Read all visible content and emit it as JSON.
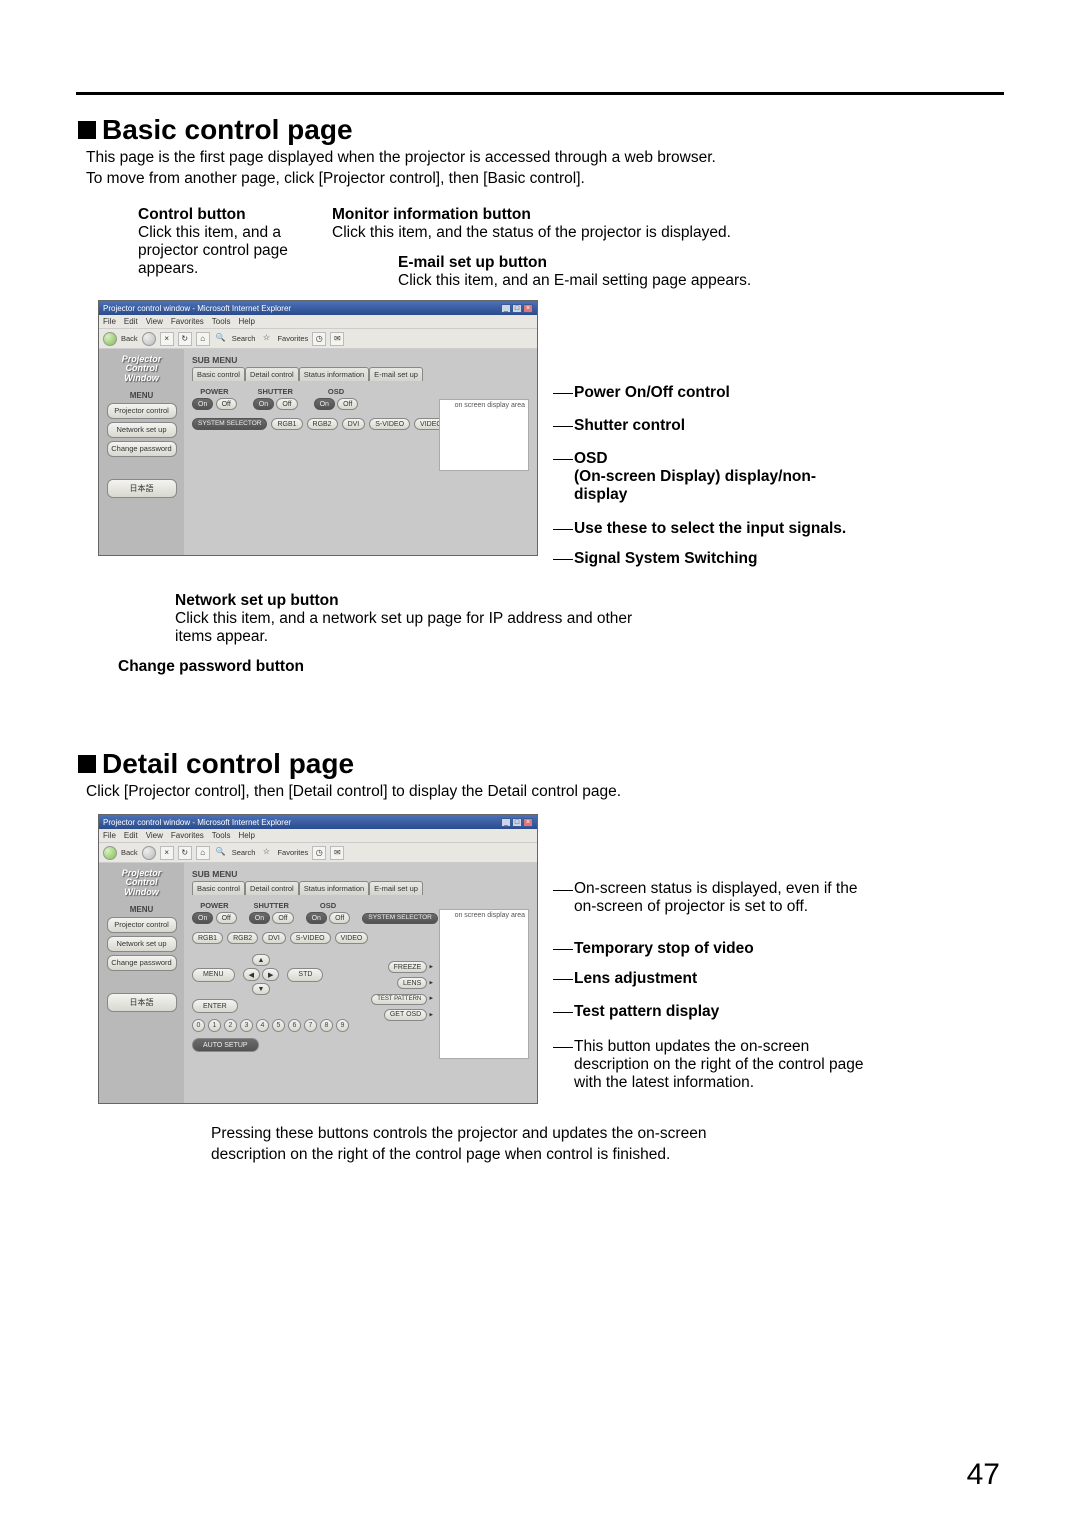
{
  "pageNumber": "47",
  "section1": {
    "title": "Basic control page",
    "intro1": "This page is the first page displayed when the projector is accessed through a web browser.",
    "intro2": "To move from another page, click [Projector control], then [Basic control].",
    "callouts": {
      "controlBtn": {
        "title": "Control button",
        "text": "Click this item, and a projector control page appears."
      },
      "monitorBtn": {
        "title": "Monitor information button",
        "text": "Click this item, and the status of the projector is displayed."
      },
      "emailBtn": {
        "title": "E-mail set up button",
        "text": "Click this item, and an E-mail setting page appears."
      },
      "networkBtn": {
        "title": "Network set up button",
        "text": "Click this item, and a network set up page for IP address and other items appear."
      },
      "changePw": {
        "title": "Change password button"
      },
      "right": {
        "power": "Power On/Off control",
        "shutter": "Shutter control",
        "osdTitle": "OSD",
        "osdSub": "(On-screen Display) display/non-display",
        "inputs": "Use these to select the input signals.",
        "signal": "Signal System Switching"
      }
    }
  },
  "section2": {
    "title": "Detail control page",
    "intro": "Click [Projector control], then [Detail control] to display the Detail control page.",
    "callouts": {
      "osdStatus": "On-screen status is displayed, even if the on-screen of projector is set to off.",
      "freeze": "Temporary stop of video",
      "lens": "Lens adjustment",
      "testPattern": "Test pattern display",
      "getOsd": "This button updates the on-screen description on the right of the control page with the latest information.",
      "bottom": "Pressing these buttons controls the projector and updates the on-screen description on the right of the control page when control is finished."
    }
  },
  "ie": {
    "title": "Projector control window - Microsoft Internet Explorer",
    "menu": [
      "File",
      "Edit",
      "View",
      "Favorites",
      "Tools",
      "Help"
    ],
    "toolSearch": "Search",
    "toolFav": "Favorites",
    "back": "Back"
  },
  "pcw": {
    "logo1": "Projector",
    "logo2": "Control",
    "logo3": "Window",
    "menuLabel": "MENU",
    "sideButtons": {
      "projectorControl": "Projector control",
      "networkSetup": "Network set up",
      "changePassword": "Change password"
    },
    "langBtn": "日本語",
    "subMenu": "SUB MENU",
    "tabs": {
      "basic": "Basic control",
      "detail": "Detail control",
      "status": "Status information",
      "email": "E-mail set up"
    },
    "osdAreaLabel": "on screen display area",
    "groups": {
      "power": "POWER",
      "shutter": "SHUTTER",
      "osd": "OSD",
      "on": "On",
      "off": "Off",
      "systemSelector": "SYSTEM SELECTOR",
      "inputs": [
        "RGB1",
        "RGB2",
        "DVI",
        "S-VIDEO",
        "VIDEO"
      ]
    },
    "detail": {
      "freeze": "FREEZE",
      "lens": "LENS",
      "testPattern": "TEST PATTERN",
      "getOsd": "GET OSD",
      "menuBtn": "MENU",
      "stdBtn": "STD",
      "enterBtn": "ENTER",
      "autoSetup": "AUTO SETUP",
      "nums": [
        "0",
        "1",
        "2",
        "3",
        "4",
        "5",
        "6",
        "7",
        "8",
        "9"
      ]
    }
  }
}
